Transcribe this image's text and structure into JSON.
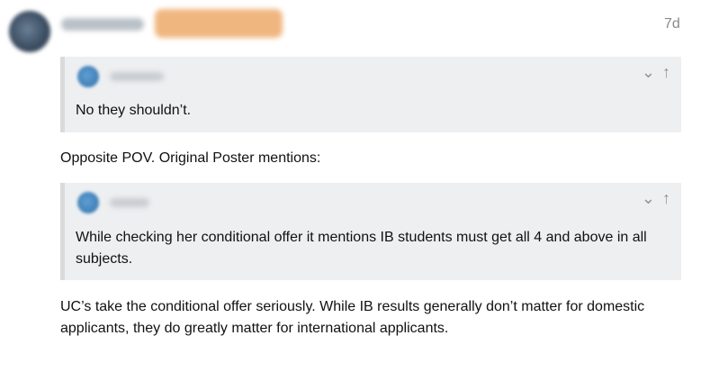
{
  "post": {
    "age": "7d",
    "quote_1": {
      "text": "No they shouldn’t."
    },
    "intro_text": "Opposite POV. Original Poster mentions:",
    "quote_2": {
      "text": "While checking her conditional offer it mentions IB students must get all 4 and above in all subjects."
    },
    "body_text": "UC’s take the conditional offer seriously. While IB results generally don’t matter for domestic applicants, they do greatly matter for international applicants."
  },
  "icons": {
    "collapse": "chevron-down-icon",
    "jump": "arrow-up-icon"
  },
  "glyphs": {
    "chevron_down": "⌄",
    "arrow_up": "↑"
  },
  "colors": {
    "quote_bg": "#eeeff1",
    "quote_border": "#d9dadc",
    "flair": "#f0b680",
    "muted_text": "#8a8a8a"
  }
}
